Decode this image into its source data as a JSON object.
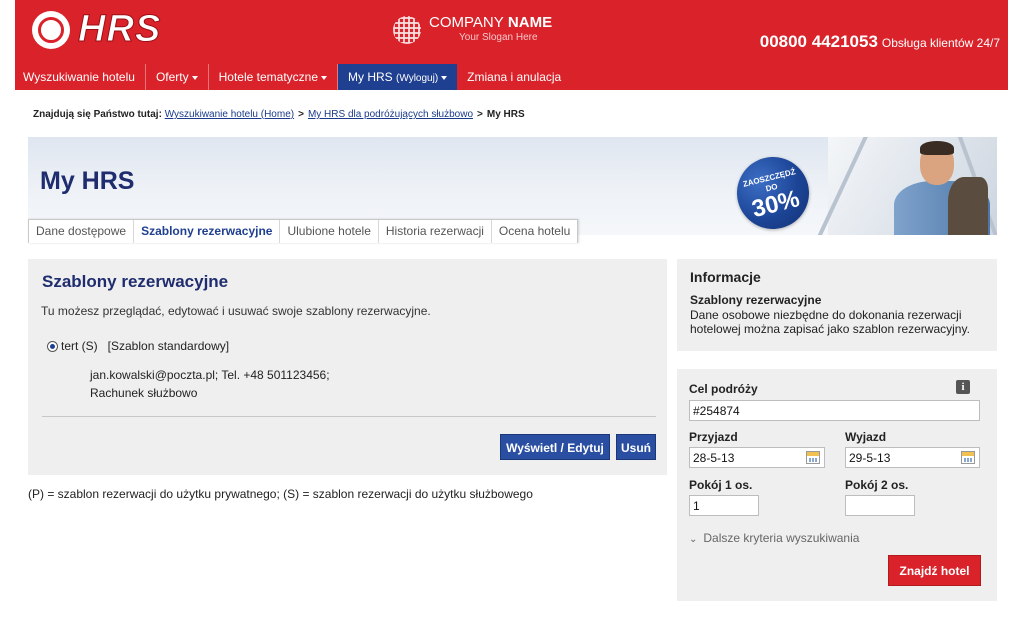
{
  "header": {
    "logo_text": "HRS",
    "company_name_light": "COMPANY",
    "company_name_bold": "NAME",
    "company_slogan": "Your Slogan Here",
    "phone": "00800 4421053",
    "phone_sub": "Obsługa klientów 24/7",
    "accent_color": "#d9222a",
    "nav_active_color": "#1f3f90"
  },
  "nav": {
    "items": [
      {
        "label": "Wyszukiwanie hotelu"
      },
      {
        "label": "Oferty"
      },
      {
        "label": "Hotele tematyczne"
      },
      {
        "label": "My HRS",
        "sub": "(Wyloguj)"
      },
      {
        "label": "Zmiana i anulacja"
      }
    ]
  },
  "breadcrumb": {
    "label": "Znajdują się Państwo tutaj:",
    "items": [
      "Wyszukiwanie hotelu (Home)",
      "My HRS dla podróżujących służbowo"
    ],
    "current": "My HRS",
    "separator": ">"
  },
  "banner": {
    "title": "My HRS",
    "badge_top": "ZAOSZCZĘDŹ",
    "badge_mid": "DO",
    "badge_big": "30%"
  },
  "tabs": [
    {
      "label": "Dane dostępowe"
    },
    {
      "label": "Szablony rezerwacyjne"
    },
    {
      "label": "Ulubione hotele"
    },
    {
      "label": "Historia rezerwacji"
    },
    {
      "label": "Ocena hotelu"
    }
  ],
  "main": {
    "title": "Szablony rezerwacyjne",
    "description": "Tu możesz przeglądać, edytować i usuwać swoje szablony rezerwacyjne.",
    "template": {
      "name": "tert (S)",
      "type": "[Szablon standardowy]",
      "contact": "jan.kowalski@poczta.pl;  Tel.  +48 501123456;",
      "account": "Rachunek  służbowo"
    },
    "view_edit_label": "Wyświetl / Edytuj",
    "delete_label": "Usuń"
  },
  "legend": "(P) = szablon rezerwacji do użytku prywatnego; (S) = szablon rezerwacji do użytku służbowego",
  "info": {
    "title": "Informacje",
    "subtitle": "Szablony rezerwacyjne",
    "text": "Dane osobowe niezbędne do dokonania rezerwacji hotelowej można zapisać jako szablon rezerwacyjny."
  },
  "search": {
    "destination_label": "Cel podróży",
    "destination_value": "#254874",
    "info_icon": "i",
    "arrival_label": "Przyjazd",
    "arrival_value": "28-5-13",
    "departure_label": "Wyjazd",
    "departure_value": "29-5-13",
    "room1_label": "Pokój 1 os.",
    "room1_value": "1",
    "room2_label": "Pokój 2 os.",
    "room2_value": "",
    "more_criteria": "Dalsze kryteria wyszukiwania",
    "find_label": "Znajdź hotel"
  }
}
